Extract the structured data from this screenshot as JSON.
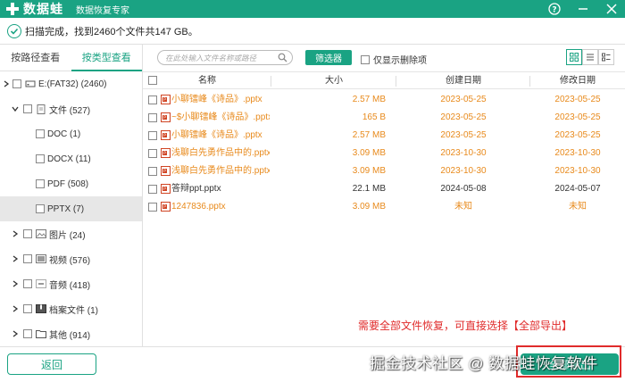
{
  "app": {
    "logo_text": "数据蛙",
    "subtitle": "数据恢复专家",
    "brand_color": "#1aa383"
  },
  "status": {
    "text": "扫描完成，找到2460个文件共147 GB。"
  },
  "left_tabs": [
    {
      "label": "按路径查看",
      "active": false
    },
    {
      "label": "按类型查看",
      "active": true
    }
  ],
  "tree": [
    {
      "label": "E:(FAT32) (2460)",
      "icon": "drive-icon",
      "expanded": true
    },
    {
      "label": "文件 (527)",
      "icon": "document-icon",
      "expanded": true
    },
    {
      "label": "DOC (1)"
    },
    {
      "label": "DOCX (11)"
    },
    {
      "label": "PDF (508)"
    },
    {
      "label": "PPTX (7)",
      "selected": true
    },
    {
      "label": "图片 (24)",
      "icon": "image-icon"
    },
    {
      "label": "视频 (576)",
      "icon": "video-icon"
    },
    {
      "label": "音频 (418)",
      "icon": "audio-icon"
    },
    {
      "label": "档案文件 (1)",
      "icon": "archive-icon"
    },
    {
      "label": "其他 (914)",
      "icon": "folder-icon"
    }
  ],
  "toolbar": {
    "search_placeholder": "在此处输入文件名称或路径",
    "filter_label": "筛选器",
    "only_deleted_label": "仅显示删除项"
  },
  "table": {
    "headers": {
      "name": "名称",
      "size": "大小",
      "created": "创建日期",
      "modified": "修改日期"
    },
    "rows": [
      {
        "name": "小聊镭峰《诗品》.pptx",
        "size": "2.57 MB",
        "created": "2023-05-25",
        "modified": "2023-05-25",
        "deleted": true
      },
      {
        "name": "~$小聊镭峰《诗品》.pptx",
        "size": "165  B",
        "created": "2023-05-25",
        "modified": "2023-05-25",
        "deleted": true
      },
      {
        "name": "小聊镭峰《诗品》.pptx",
        "size": "2.57 MB",
        "created": "2023-05-25",
        "modified": "2023-05-25",
        "deleted": true
      },
      {
        "name": "浅聊白先勇作品中的.pptx",
        "size": "3.09 MB",
        "created": "2023-10-30",
        "modified": "2023-10-30",
        "deleted": true
      },
      {
        "name": "浅聊白先勇作品中的.pptx",
        "size": "3.09 MB",
        "created": "2023-10-30",
        "modified": "2023-10-30",
        "deleted": true
      },
      {
        "name": "答辩ppt.pptx",
        "size": "22.1 MB",
        "created": "2024-05-08",
        "modified": "2024-05-07",
        "deleted": false
      },
      {
        "name": "1247836.pptx",
        "size": "3.09 MB",
        "created": "未知",
        "modified": "未知",
        "deleted": true
      }
    ]
  },
  "bottom": {
    "back_label": "返回",
    "export_label": "全部导出",
    "annotation": "需要全部文件恢复，可直接选择【全部导出】",
    "watermark": "掘金技术社区 @ 数据蛙恢复软件"
  }
}
